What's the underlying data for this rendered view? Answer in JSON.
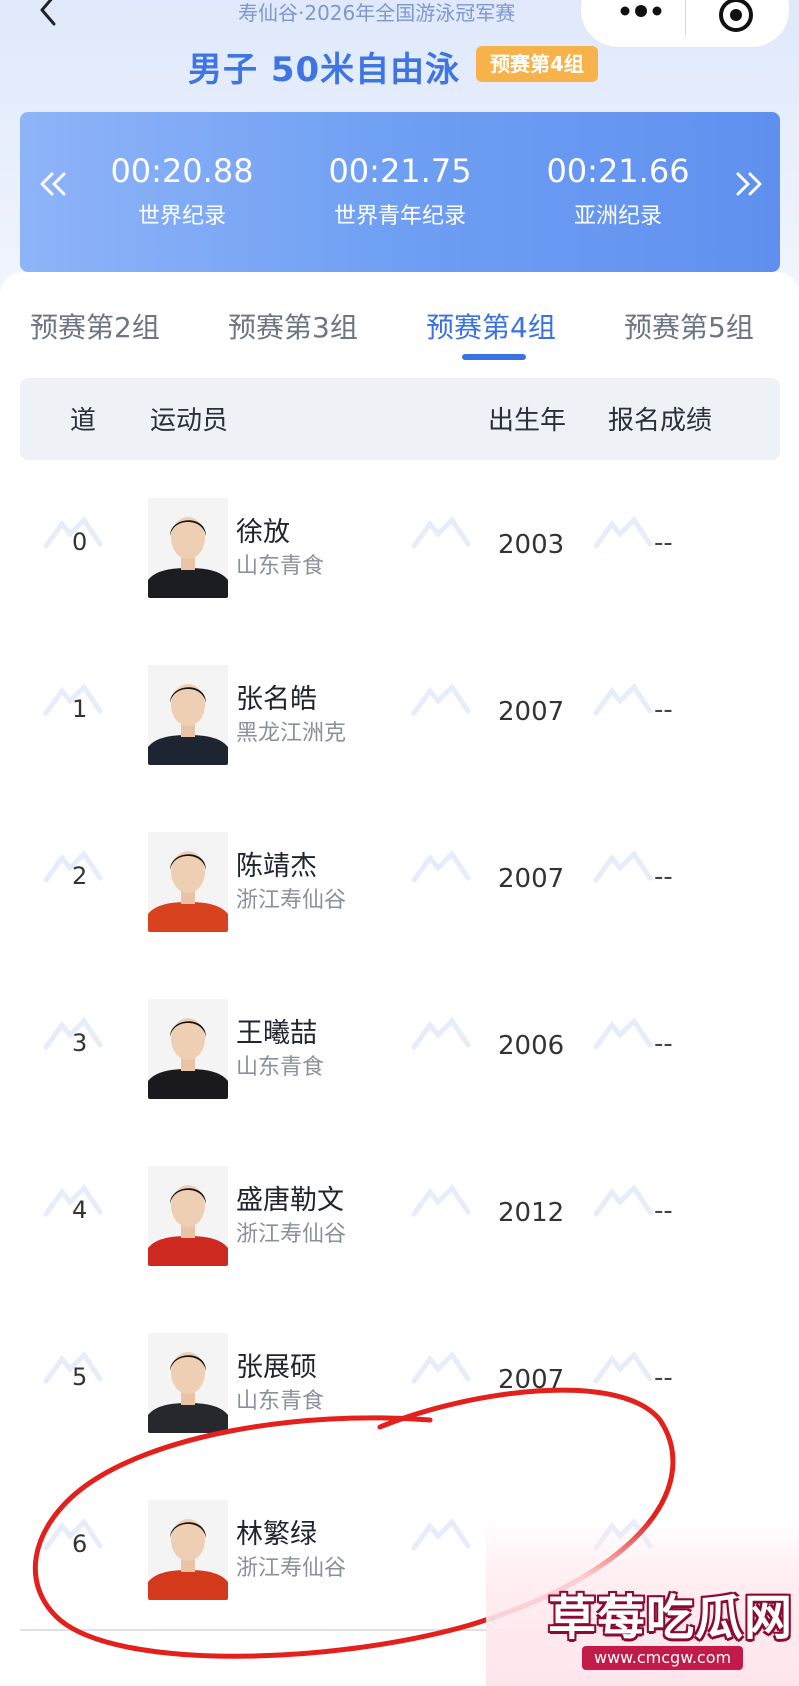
{
  "header": {
    "event_name": "寿仙谷·2026年全国游泳冠军赛",
    "title": "男子 50米自由泳",
    "heat_badge": "预赛第4组",
    "capsule": {
      "icons": [
        "more-dots-icon",
        "target-icon"
      ]
    }
  },
  "records": [
    {
      "time": "00:20.88",
      "label": "世界纪录"
    },
    {
      "time": "00:21.75",
      "label": "世界青年纪录"
    },
    {
      "time": "00:21.66",
      "label": "亚洲纪录"
    }
  ],
  "tabs": [
    {
      "label": "预赛第2组",
      "active": false
    },
    {
      "label": "预赛第3组",
      "active": false
    },
    {
      "label": "预赛第4组",
      "active": true
    },
    {
      "label": "预赛第5组",
      "active": false
    }
  ],
  "table": {
    "headers": {
      "lane": "道",
      "athlete": "运动员",
      "birth_year": "出生年",
      "entry_time": "报名成绩"
    },
    "rows": [
      {
        "lane": "0",
        "name": "徐放",
        "team": "山东青食",
        "birth_year": "2003",
        "entry_time": "--",
        "shirt": "#1c1d22"
      },
      {
        "lane": "1",
        "name": "张名皓",
        "team": "黑龙江洲克",
        "birth_year": "2007",
        "entry_time": "--",
        "shirt": "#1e2532"
      },
      {
        "lane": "2",
        "name": "陈靖杰",
        "team": "浙江寿仙谷",
        "birth_year": "2007",
        "entry_time": "--",
        "shirt": "#d8421e"
      },
      {
        "lane": "3",
        "name": "王曦喆",
        "team": "山东青食",
        "birth_year": "2006",
        "entry_time": "--",
        "shirt": "#1a1a1e"
      },
      {
        "lane": "4",
        "name": "盛唐勒文",
        "team": "浙江寿仙谷",
        "birth_year": "2012",
        "entry_time": "--",
        "shirt": "#cf2a22"
      },
      {
        "lane": "5",
        "name": "张展硕",
        "team": "山东青食",
        "birth_year": "2007",
        "entry_time": "--",
        "shirt": "#26282e"
      },
      {
        "lane": "6",
        "name": "林繁绿",
        "team": "浙江寿仙谷",
        "birth_year": "",
        "entry_time": "",
        "shirt": "#d33a1c"
      }
    ]
  },
  "watermark_overlay": {
    "main": "草莓吃瓜网",
    "url": "www.cmcgw.com"
  }
}
